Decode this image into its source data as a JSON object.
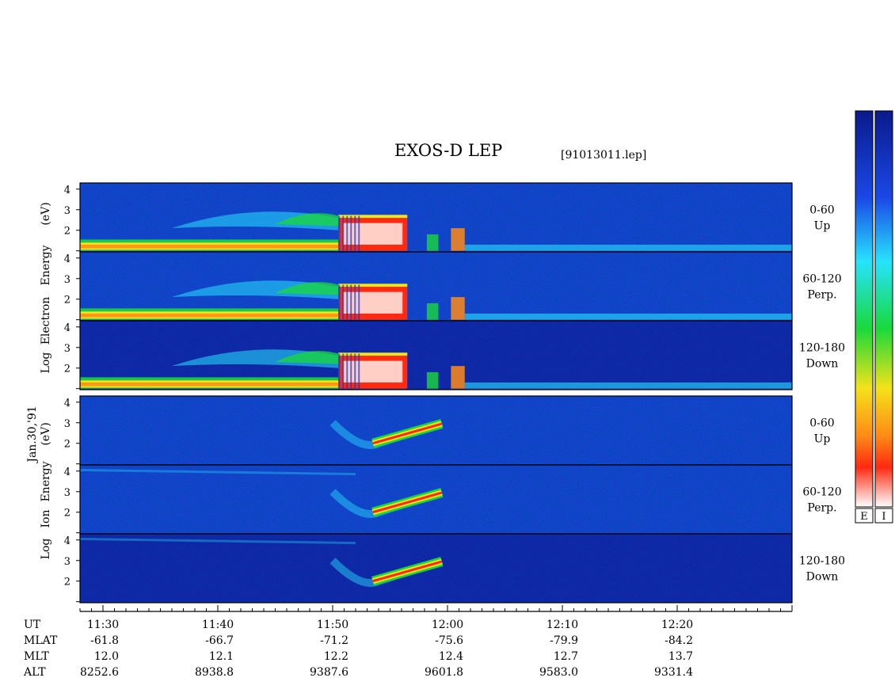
{
  "chart_data": {
    "type": "heatmap",
    "title": "EXOS-D LEP",
    "file_label": "[91013011.lep]",
    "date_label": "Jan.30,'91",
    "colors": {
      "dark_blue": "#0a1a8c",
      "blue": "#1a48e6",
      "cyan": "#27e3ff",
      "green": "#19d93a",
      "yellow": "#f3e31a",
      "orange": "#ff8b16",
      "red": "#ff2a10",
      "white": "#ffffff"
    },
    "groups": [
      {
        "species": "Electron",
        "ylabel_lines": [
          "Log",
          "Electron",
          "Energy",
          "(eV)"
        ],
        "yrange": [
          1,
          4
        ],
        "yticks": [
          "4",
          "3",
          "2"
        ],
        "panels": [
          {
            "angle": "0-60",
            "direction": "Up"
          },
          {
            "angle": "60-120",
            "direction": "Perp."
          },
          {
            "angle": "120-180",
            "direction": "Down"
          }
        ]
      },
      {
        "species": "Ion",
        "ylabel_lines": [
          "Log",
          "Ion",
          "Energy",
          "(eV)"
        ],
        "yrange": [
          1,
          4
        ],
        "yticks": [
          "4",
          "3",
          "2"
        ],
        "panels": [
          {
            "angle": "0-60",
            "direction": "Up"
          },
          {
            "angle": "60-120",
            "direction": "Perp."
          },
          {
            "angle": "120-180",
            "direction": "Down"
          }
        ]
      }
    ],
    "colorbars": [
      {
        "label": "E"
      },
      {
        "label": "I"
      }
    ],
    "xaxis": {
      "row_labels": [
        "UT",
        "MLAT",
        "MLT",
        "ALT"
      ],
      "ticks": [
        {
          "UT": "11:30",
          "MLAT": "-61.8",
          "MLT": "12.0",
          "ALT": "8252.6"
        },
        {
          "UT": "11:40",
          "MLAT": "-66.7",
          "MLT": "12.1",
          "ALT": "8938.8"
        },
        {
          "UT": "11:50",
          "MLAT": "-71.2",
          "MLT": "12.2",
          "ALT": "9387.6"
        },
        {
          "UT": "12:00",
          "MLAT": "-75.6",
          "MLT": "12.4",
          "ALT": "9601.8"
        },
        {
          "UT": "12:10",
          "MLAT": "-79.9",
          "MLT": "12.7",
          "ALT": "9583.0"
        },
        {
          "UT": "12:20",
          "MLAT": "-84.2",
          "MLT": "13.7",
          "ALT": "9331.4"
        }
      ],
      "ut_start_min": 688,
      "ut_end_min": 750
    }
  }
}
